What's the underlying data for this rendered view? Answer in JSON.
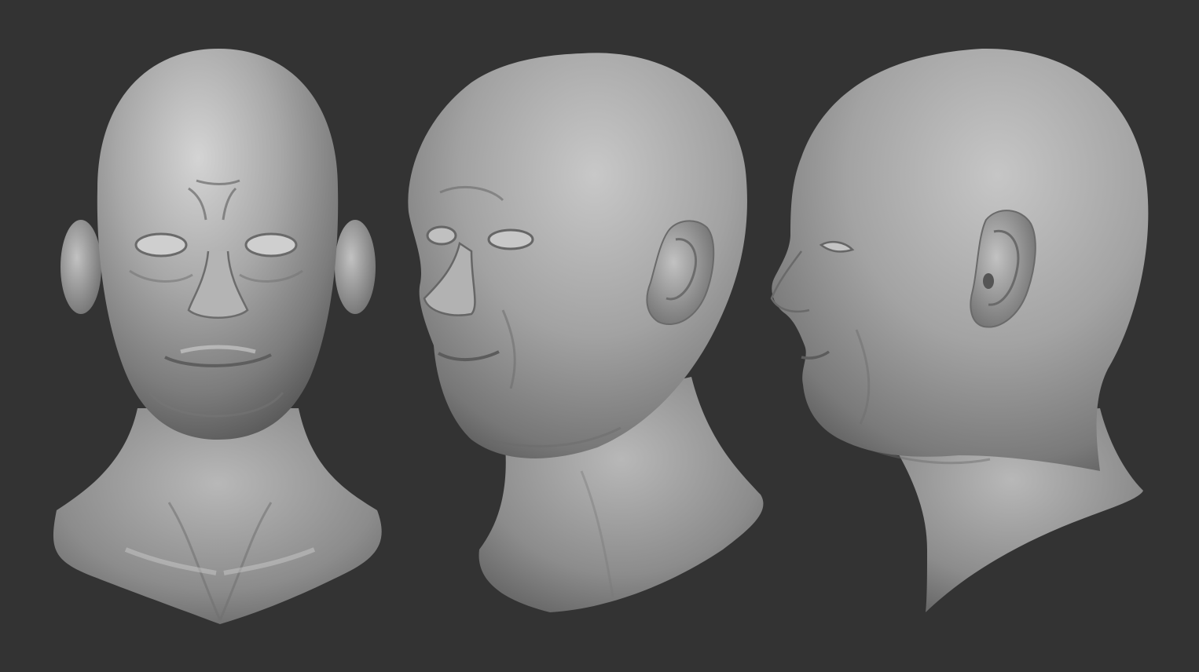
{
  "scene": {
    "background_color": "#333333",
    "material_color": "#a6a6a6",
    "material_highlight": "#d2d2d2",
    "material_shadow": "#5a5a5a",
    "views": [
      {
        "name": "front-view",
        "description": "front"
      },
      {
        "name": "three-quarter-view",
        "description": "three-quarter"
      },
      {
        "name": "profile-view",
        "description": "side"
      }
    ]
  }
}
